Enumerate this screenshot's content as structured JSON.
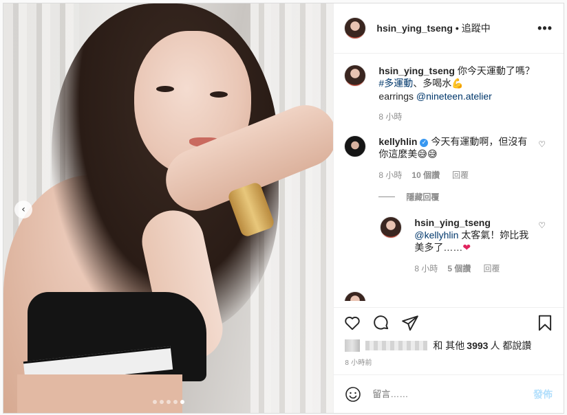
{
  "post": {
    "username": "hsin_ying_tseng",
    "separator": "•",
    "follow_status": "追蹤中",
    "more_label": "•••"
  },
  "photo": {
    "prev_label": "‹",
    "dot_count": 5,
    "active_dot": 4
  },
  "caption": {
    "username": "hsin_ying_tseng",
    "line1": "你今天運動了嗎？",
    "hashtag": "#多運動",
    "line2_rest": "、多喝水",
    "flex_emoji": "💪",
    "line3_prefix": "earrings",
    "mention": "@nineteen.atelier",
    "time": "8 小時"
  },
  "comments": [
    {
      "username": "kellyhlin",
      "verified_mark": "✓",
      "text": "今天有運動啊，但沒有你這麼美",
      "emoji": "😅😅",
      "time": "8 小時",
      "likes": "10 個讚",
      "reply_label": "回覆"
    }
  ],
  "hide_replies_label": "隱藏回覆",
  "reply": {
    "username": "hsin_ying_tseng",
    "mention": "@kellyhlin",
    "text": "太客氣！妳比我美多了……",
    "heart": "❤",
    "time": "8 小時",
    "likes": "5 個讚",
    "reply_label": "回覆"
  },
  "likes_line": {
    "prefix": "和 其他",
    "count": "3993",
    "suffix": "人 都說讚"
  },
  "timestamp": "8 小時前",
  "add_comment": {
    "placeholder": "留言……",
    "post_label": "發佈"
  },
  "colors": {
    "link": "#00376b",
    "muted": "#8e8e8e",
    "post_disabled": "#b2dffc",
    "verified": "#3897f0"
  }
}
